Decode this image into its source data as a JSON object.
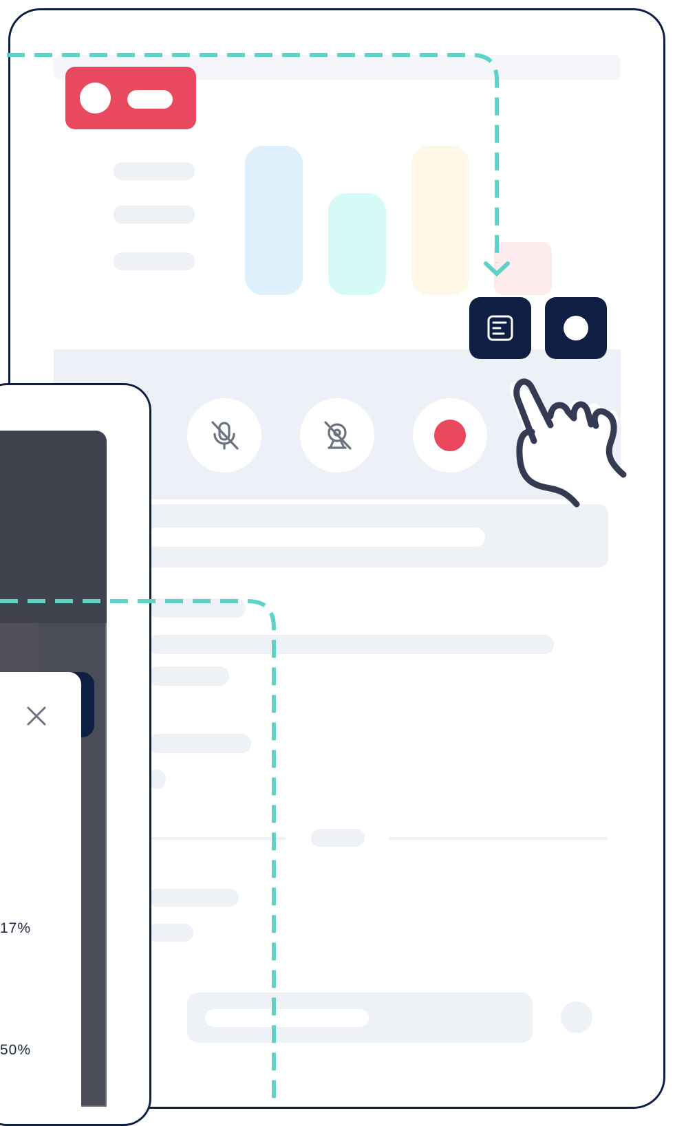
{
  "illustration": {
    "main_window": {
      "toolbar_buttons": [
        {
          "icon": "notes-icon"
        },
        {
          "icon": "record-dot-icon"
        }
      ],
      "call_controls": [
        {
          "icon": "mic-off-icon"
        },
        {
          "icon": "camera-off-icon"
        },
        {
          "icon": "record-icon"
        }
      ],
      "hand_cursor": "pointer-hand-icon"
    },
    "side_panel": {
      "close_icon": "close-icon",
      "stats": [
        {
          "label": "17%"
        },
        {
          "label": "50%"
        }
      ]
    },
    "colors": {
      "frame": "#0f1f44",
      "accent": "#e8495f",
      "dash": "#5dd3c7",
      "bar_blue": "#dff0fd",
      "bar_mint": "#d6fbf6",
      "bar_cream": "#fff7e6",
      "bar_pink": "#fdebee"
    }
  }
}
